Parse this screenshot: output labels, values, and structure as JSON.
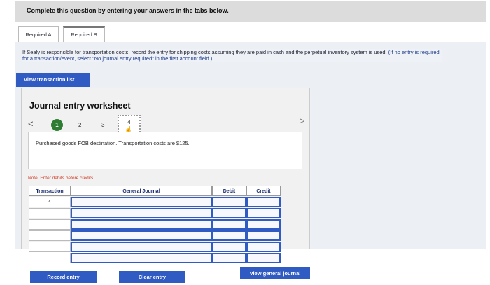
{
  "header": {
    "text": "Complete this question by entering your answers in the tabs below."
  },
  "tabs": [
    {
      "label": "Required A"
    },
    {
      "label": "Required B"
    }
  ],
  "instruction": {
    "main": "If Sealy is responsible for transportation costs, record the entry for shipping costs assuming they are paid in cash and the perpetual inventory system is used.",
    "note": "(If no entry is required for a transaction/event, select \"No journal entry required\" in the first account field.)"
  },
  "buttons": {
    "view_transaction_list": "View transaction list",
    "record_entry": "Record entry",
    "clear_entry": "Clear entry",
    "view_general_journal": "View general journal"
  },
  "worksheet": {
    "title": "Journal entry worksheet",
    "nav_prev": "<",
    "nav_next": ">",
    "steps": [
      "1",
      "2",
      "3",
      "4"
    ],
    "description": "Purchased goods FOB destination. Transportation costs are $125.",
    "note": "Note: Enter debits before credits."
  },
  "table": {
    "headers": {
      "transaction": "Transaction",
      "general_journal": "General Journal",
      "debit": "Debit",
      "credit": "Credit"
    },
    "rows": [
      {
        "transaction": "4",
        "general_journal": "",
        "debit": "",
        "credit": ""
      },
      {
        "transaction": "",
        "general_journal": "",
        "debit": "",
        "credit": ""
      },
      {
        "transaction": "",
        "general_journal": "",
        "debit": "",
        "credit": ""
      },
      {
        "transaction": "",
        "general_journal": "",
        "debit": "",
        "credit": ""
      },
      {
        "transaction": "",
        "general_journal": "",
        "debit": "",
        "credit": ""
      },
      {
        "transaction": "",
        "general_journal": "",
        "debit": "",
        "credit": ""
      }
    ]
  },
  "colors": {
    "primary_button": "#2f5bc2",
    "step_active": "#2e7d32",
    "note_red": "#d0402b"
  }
}
